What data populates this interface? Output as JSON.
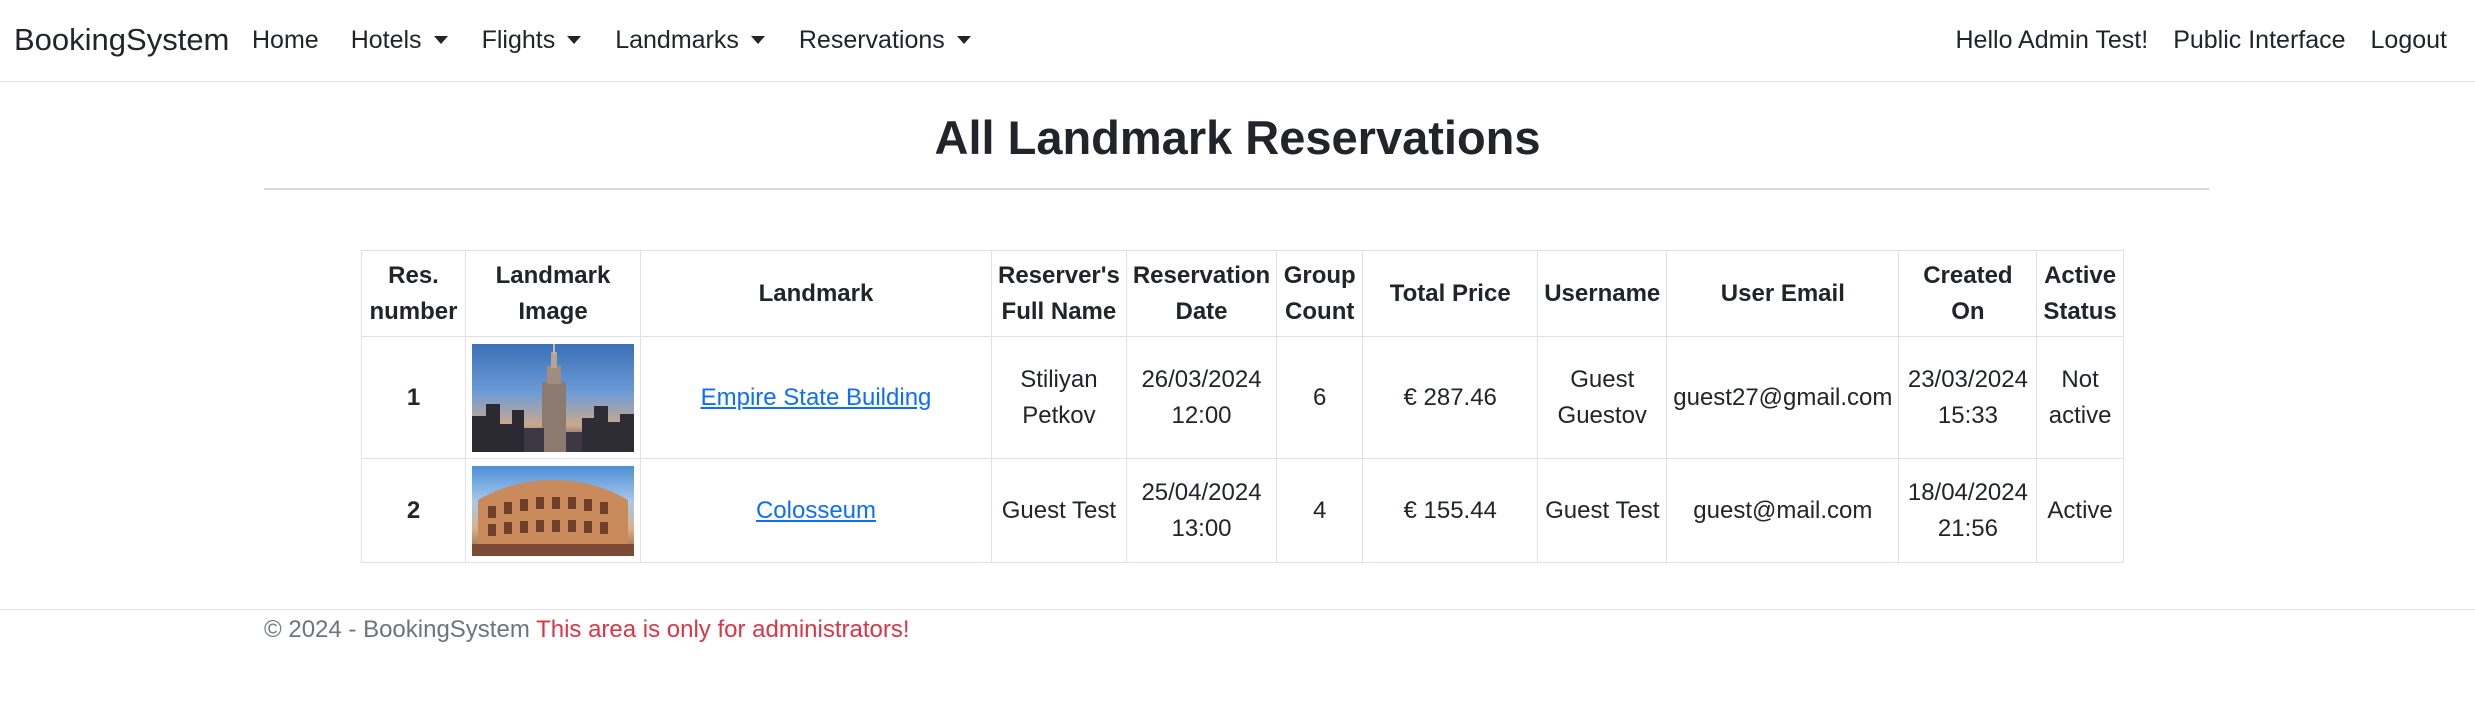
{
  "navbar": {
    "brand": "BookingSystem",
    "home": "Home",
    "dropdowns": [
      "Hotels",
      "Flights",
      "Landmarks",
      "Reservations"
    ],
    "greeting": "Hello Admin Test!",
    "public_interface": "Public Interface",
    "logout": "Logout"
  },
  "page": {
    "title": "All Landmark Reservations"
  },
  "table": {
    "headers": [
      "Res. number",
      "Landmark Image",
      "Landmark",
      "Reserver's Full Name",
      "Reservation Date",
      "Group Count",
      "Total Price",
      "Username",
      "User Email",
      "Created On",
      "Active Status"
    ],
    "rows": [
      {
        "number": "1",
        "image": "empire-state-building-photo",
        "landmark": "Empire State Building",
        "full_name": "Stiliyan Petkov",
        "reservation_date": "26/03/2024 12:00",
        "group_count": "6",
        "total_price": "€ 287.46",
        "username": "Guest Guestov",
        "email": "guest27@gmail.com",
        "created_on": "23/03/2024 15:33",
        "status": "Not active"
      },
      {
        "number": "2",
        "image": "colosseum-photo",
        "landmark": "Colosseum",
        "full_name": "Guest Test",
        "reservation_date": "25/04/2024 13:00",
        "group_count": "4",
        "total_price": "€ 155.44",
        "username": "Guest Test",
        "email": "guest@mail.com",
        "created_on": "18/04/2024 21:56",
        "status": "Active"
      }
    ]
  },
  "footer": {
    "copyright": "© 2024 - BookingSystem",
    "notice": "This area is only for administrators!"
  },
  "colors": {
    "link": "#0d6efd",
    "warning": "#dc3545",
    "muted": "#6c757d"
  }
}
